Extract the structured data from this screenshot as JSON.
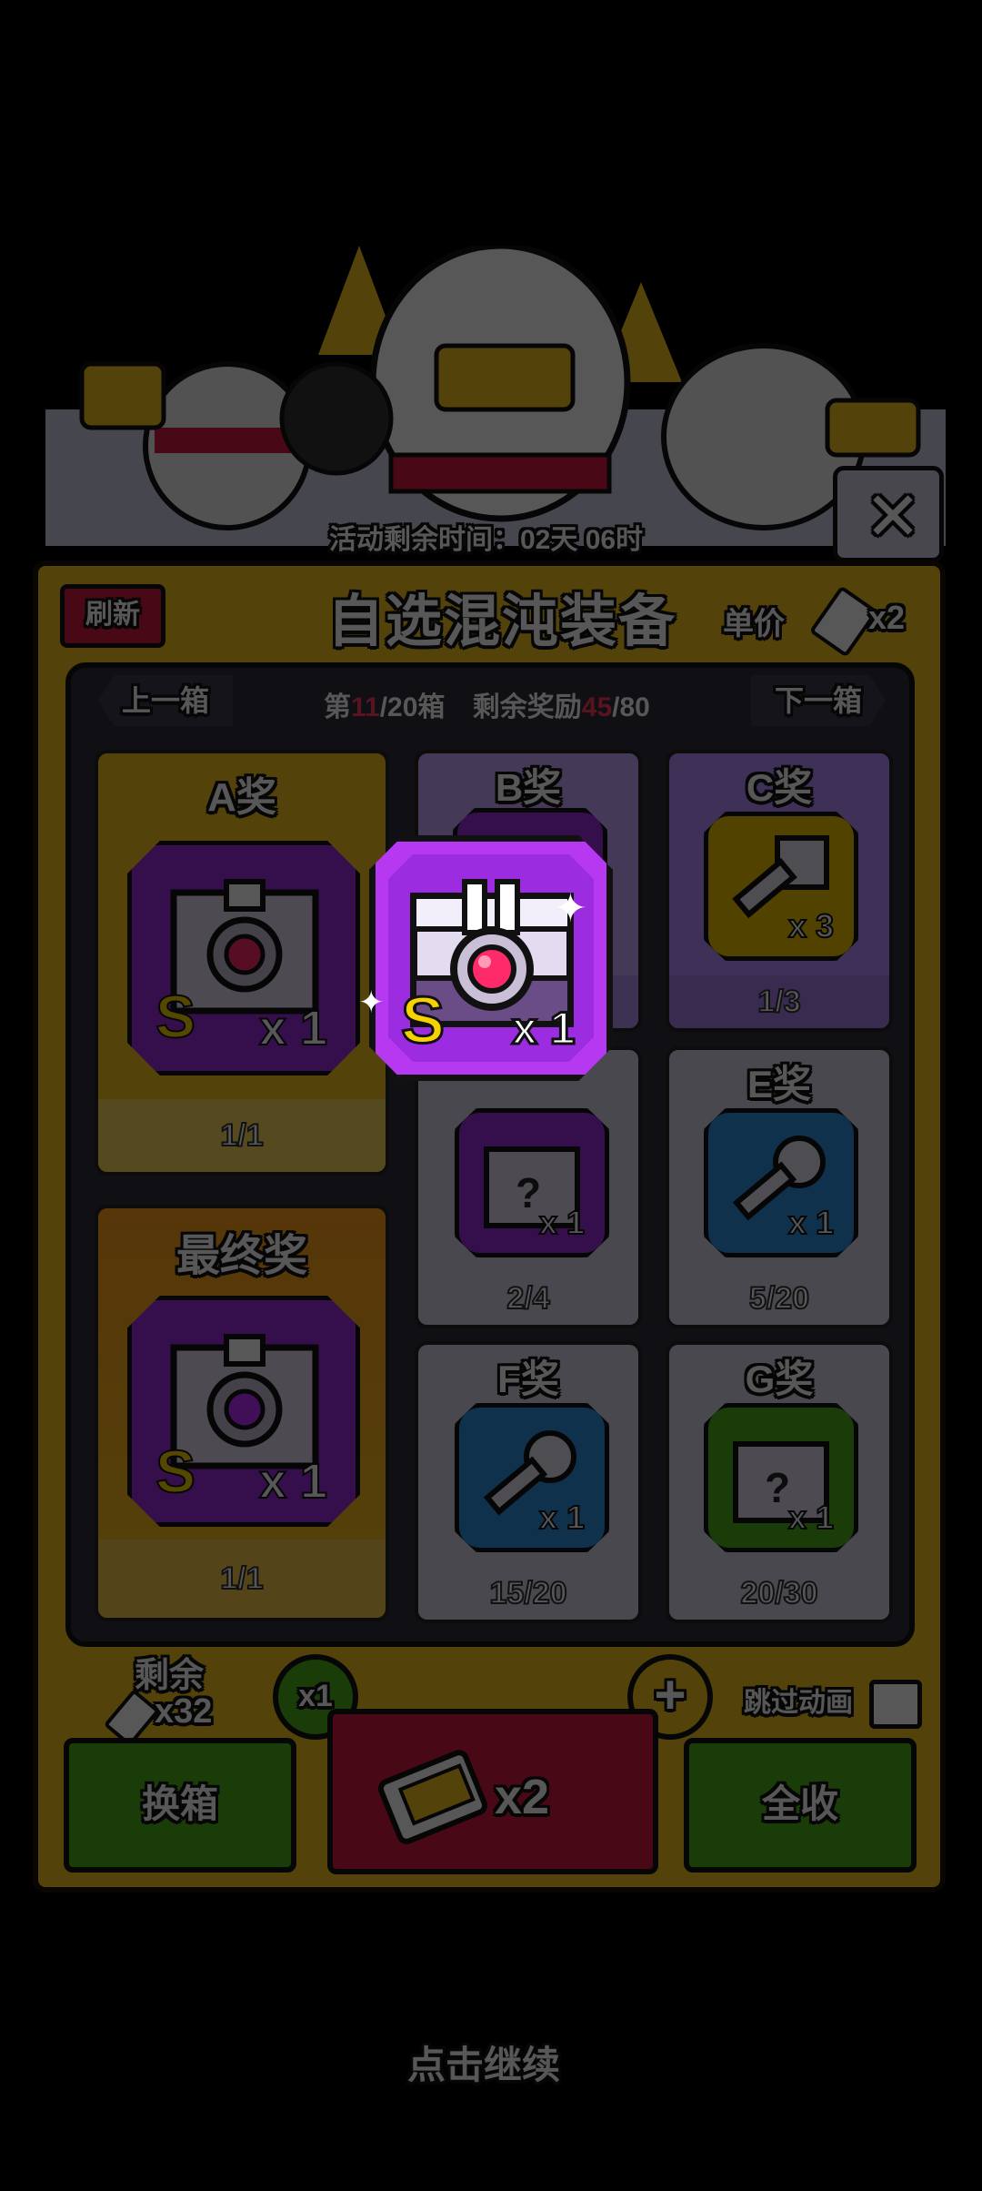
{
  "header": {
    "timer_label": "活动剩余时间：",
    "timer_value": "02天 06时"
  },
  "panel": {
    "refresh_label": "刷新",
    "title": "自选混沌装备",
    "unit_price_label": "单价",
    "unit_price_qty": "x2",
    "nav": {
      "prev_label": "上一箱",
      "next_label": "下一箱",
      "box_prefix": "第",
      "box_current": "11",
      "box_total": "/20箱",
      "reward_prefix": "剩余奖励",
      "reward_current": "45",
      "reward_total": "/80"
    }
  },
  "prizes": {
    "A": {
      "title": "A奖",
      "grade": "S",
      "qty": "x 1",
      "progress": "1/1"
    },
    "final": {
      "title": "最终奖",
      "grade": "S",
      "qty": "x 1",
      "progress": "1/1"
    },
    "B": {
      "title": "B奖"
    },
    "C": {
      "title": "C奖",
      "qty": "x 3",
      "progress": "1/3"
    },
    "D": {
      "qty": "x 1",
      "progress": "2/4"
    },
    "E": {
      "title": "E奖",
      "qty": "x 1",
      "progress": "5/20"
    },
    "F": {
      "title": "F奖",
      "qty": "x 1",
      "progress": "15/20"
    },
    "G": {
      "title": "G奖",
      "qty": "x 1",
      "progress": "20/30"
    }
  },
  "popup": {
    "grade": "S",
    "qty": "x 1"
  },
  "bottom": {
    "remaining_label": "剩余",
    "remaining_qty": "x32",
    "multiplier": "x1",
    "skip_label": "跳过动画",
    "swap_label": "换箱",
    "draw_qty": "x2",
    "collect_label": "全收"
  },
  "continue_hint": "点击继续",
  "colors": {
    "panel": "#f5c21d",
    "purple": "#9b2ce0",
    "green": "#4caf1a",
    "red": "#d8173d",
    "blue": "#2c8fe0",
    "yellow": "#f2c300"
  }
}
